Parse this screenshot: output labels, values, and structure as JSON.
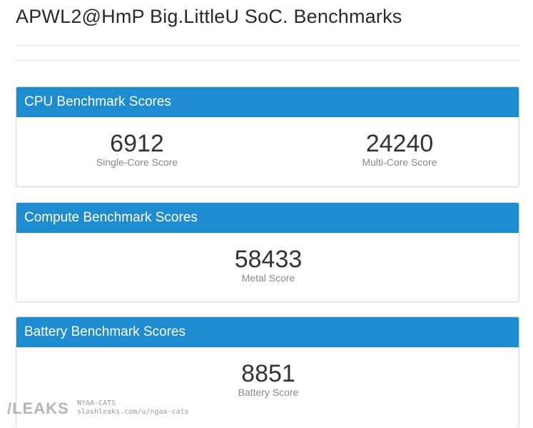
{
  "page": {
    "title": "APWL2@HmP Big.LittleU SoC. Benchmarks"
  },
  "cpu": {
    "header": "CPU Benchmark Scores",
    "single_core": {
      "value": "6912",
      "label": "Single-Core Score"
    },
    "multi_core": {
      "value": "24240",
      "label": "Multi-Core Score"
    }
  },
  "compute": {
    "header": "Compute Benchmark Scores",
    "metal": {
      "value": "58433",
      "label": "Metal Score"
    }
  },
  "battery": {
    "header": "Battery Benchmark Scores",
    "battery_score": {
      "value": "8851",
      "label": "Battery Score"
    }
  },
  "watermark": {
    "logo": "/LEAKS",
    "user": "NYAA-CATS",
    "url": "slashleaks.com/u/ngaa-cats"
  },
  "colors": {
    "header_bg": "#1f8ccf",
    "header_text": "#ffffff",
    "score_text": "#333333",
    "label_text": "#888888"
  }
}
